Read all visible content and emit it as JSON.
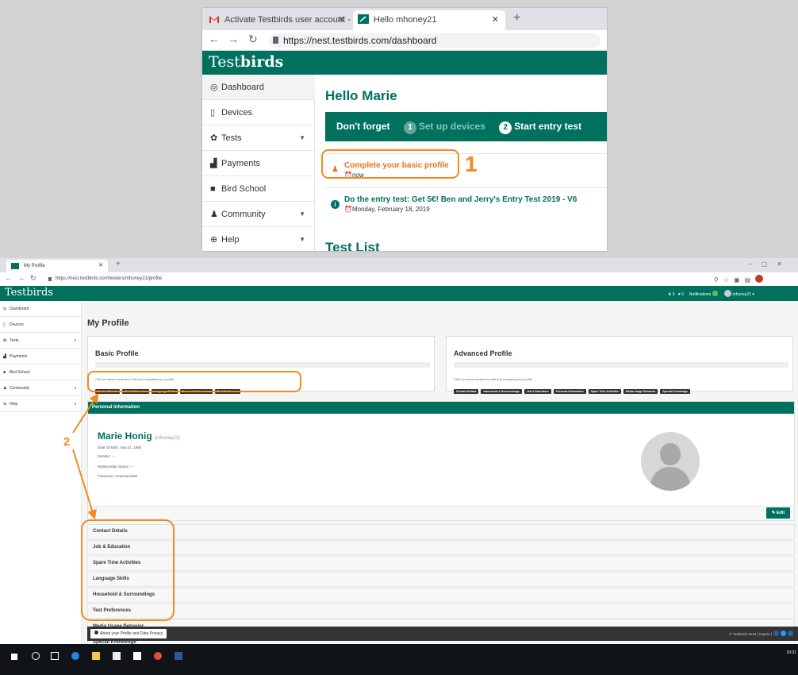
{
  "shot1": {
    "tabs": [
      {
        "label": "Activate Testbirds user account -",
        "icon": "gmail-icon"
      },
      {
        "label": "Hello mhoney21",
        "icon": "testbirds-favicon"
      }
    ],
    "url": "https://nest.testbirds.com/dashboard",
    "logo_light": "Test",
    "logo_bold": "birds",
    "sidebar": [
      {
        "label": "Dashboard",
        "icon": "gauge-icon",
        "glyph": "◎"
      },
      {
        "label": "Devices",
        "icon": "mobile-icon",
        "glyph": "▯"
      },
      {
        "label": "Tests",
        "icon": "gear-icon",
        "glyph": "✿"
      },
      {
        "label": "Payments",
        "icon": "bar-chart-icon",
        "glyph": "▟"
      },
      {
        "label": "Bird School",
        "icon": "book-icon",
        "glyph": "■"
      },
      {
        "label": "Community",
        "icon": "users-icon",
        "glyph": "♟"
      },
      {
        "label": "Help",
        "icon": "lifebuoy-icon",
        "glyph": "⊕"
      }
    ],
    "greeting": "Hello Marie",
    "dont_forget": {
      "label": "Don't forget",
      "step1_num": "1",
      "step1_text": "Set up devices",
      "step2_num": "2",
      "step2_text": "Start entry test"
    },
    "notifications": [
      {
        "title": "Complete your basic profile",
        "time": "now"
      },
      {
        "title": "Do the entry test: Get 5€! Ben and Jerry's Entry Test 2019 - V6",
        "time": "Monday, February 18, 2019"
      }
    ],
    "test_list_heading": "Test List",
    "callout_number": "1"
  },
  "shot2": {
    "tab_label": "My Profile",
    "url": "https://nest.testbirds.com/testers/mhoney21/profile",
    "logo": "Testbirds",
    "header_right": {
      "stat1": "5",
      "stat2": "0",
      "notifications": "Notifications",
      "badge": "0",
      "user": "mhoney21"
    },
    "sidebar": [
      {
        "label": "Dashboard",
        "glyph": "◎"
      },
      {
        "label": "Devices",
        "glyph": "▯"
      },
      {
        "label": "Tests",
        "glyph": "✿"
      },
      {
        "label": "Payments",
        "glyph": "▟"
      },
      {
        "label": "Bird School",
        "glyph": "■"
      },
      {
        "label": "Community",
        "glyph": "♟"
      },
      {
        "label": "Help",
        "glyph": "⊕"
      }
    ],
    "page_title": "My Profile",
    "basic": {
      "title": "Basic Profile",
      "hint": "Click on these sections to edit and complete your profile.",
      "buttons": [
        "Contact Details",
        "Job & Education",
        "Language Skills",
        "Personal Information",
        "Test Preference"
      ]
    },
    "advanced": {
      "title": "Advanced Profile",
      "hint": "Click on these sections to edit and complete your profile.",
      "buttons": [
        "Contact Details",
        "Household & Surroundings",
        "Job & Education",
        "Personal Information",
        "Spare Time Activities",
        "Media Usage Behavior",
        "Special Knowledge"
      ]
    },
    "personal": {
      "header": "Personal Information",
      "name": "Marie Honig",
      "nick": "(mhoney21)",
      "dob": "Date Of Birth: Sep 21, 1980",
      "gender": "Gender: ---",
      "relationship": "Relationship Status: ---",
      "timezone": "Timezone: America/Adak"
    },
    "edit_label": "Edit",
    "sections": [
      "Contact Details",
      "Job & Education",
      "Spare Time Activities",
      "Language Skills",
      "Household & Surroundings",
      "Test Preferences",
      "Media Usage Behavior",
      "Special Knowledge"
    ],
    "footer_left": "About your Profile and Data Privacy",
    "footer_right": "© Testbirds 2019 | Imprint |",
    "clock": "10:21",
    "callout_number": "2"
  },
  "colors": {
    "brand": "#00715e",
    "accent": "#f4891f",
    "alert": "#e8721c"
  }
}
